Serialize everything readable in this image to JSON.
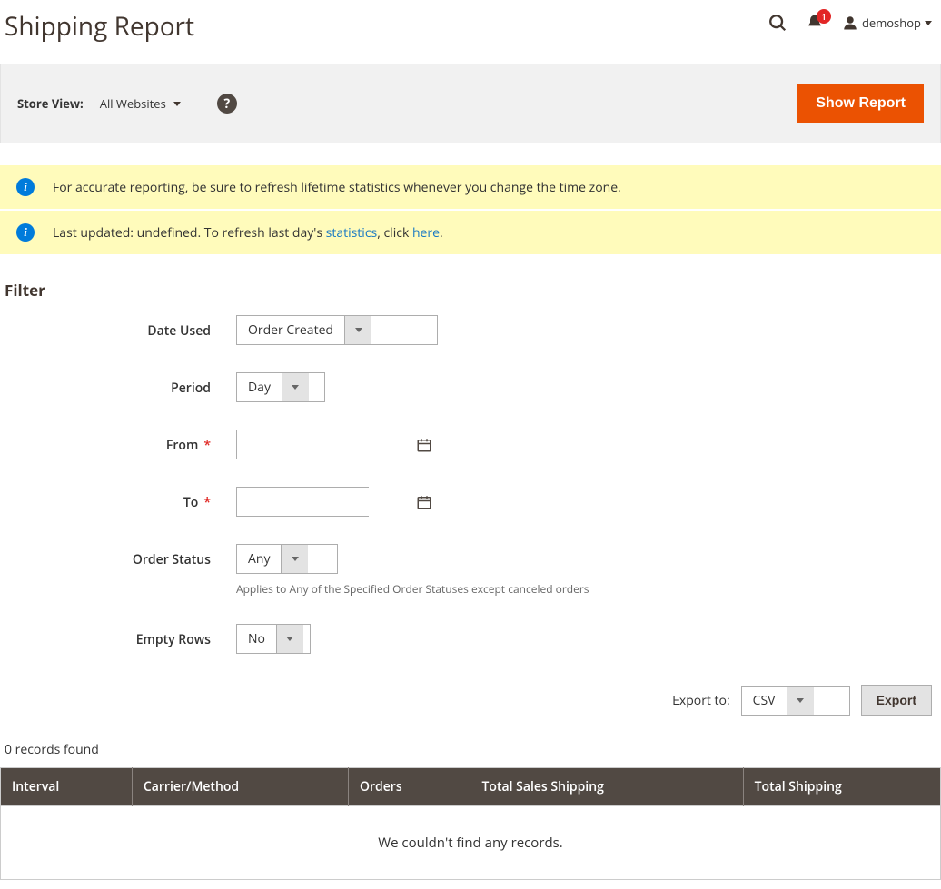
{
  "header": {
    "title": "Shipping Report",
    "notif_count": "1",
    "user_name": "demoshop"
  },
  "store_view": {
    "label": "Store View:",
    "value": "All Websites",
    "show_report_label": "Show Report"
  },
  "notices": {
    "accurate": "For accurate reporting, be sure to refresh lifetime statistics whenever you change the time zone.",
    "updated_prefix": "Last updated: undefined. To refresh last day's ",
    "statistics_link": "statistics",
    "updated_mid": ", click ",
    "here_link": "here",
    "updated_suffix": "."
  },
  "filter": {
    "title": "Filter",
    "date_used": {
      "label": "Date Used",
      "value": "Order Created"
    },
    "period": {
      "label": "Period",
      "value": "Day"
    },
    "from": {
      "label": "From",
      "value": ""
    },
    "to": {
      "label": "To",
      "value": ""
    },
    "order_status": {
      "label": "Order Status",
      "value": "Any",
      "note": "Applies to Any of the Specified Order Statuses except canceled orders"
    },
    "empty_rows": {
      "label": "Empty Rows",
      "value": "No"
    }
  },
  "export": {
    "label": "Export to:",
    "value": "CSV",
    "button": "Export"
  },
  "grid": {
    "records_found": "0 records found",
    "columns": [
      "Interval",
      "Carrier/Method",
      "Orders",
      "Total Sales Shipping",
      "Total Shipping"
    ],
    "empty_message": "We couldn't find any records."
  }
}
